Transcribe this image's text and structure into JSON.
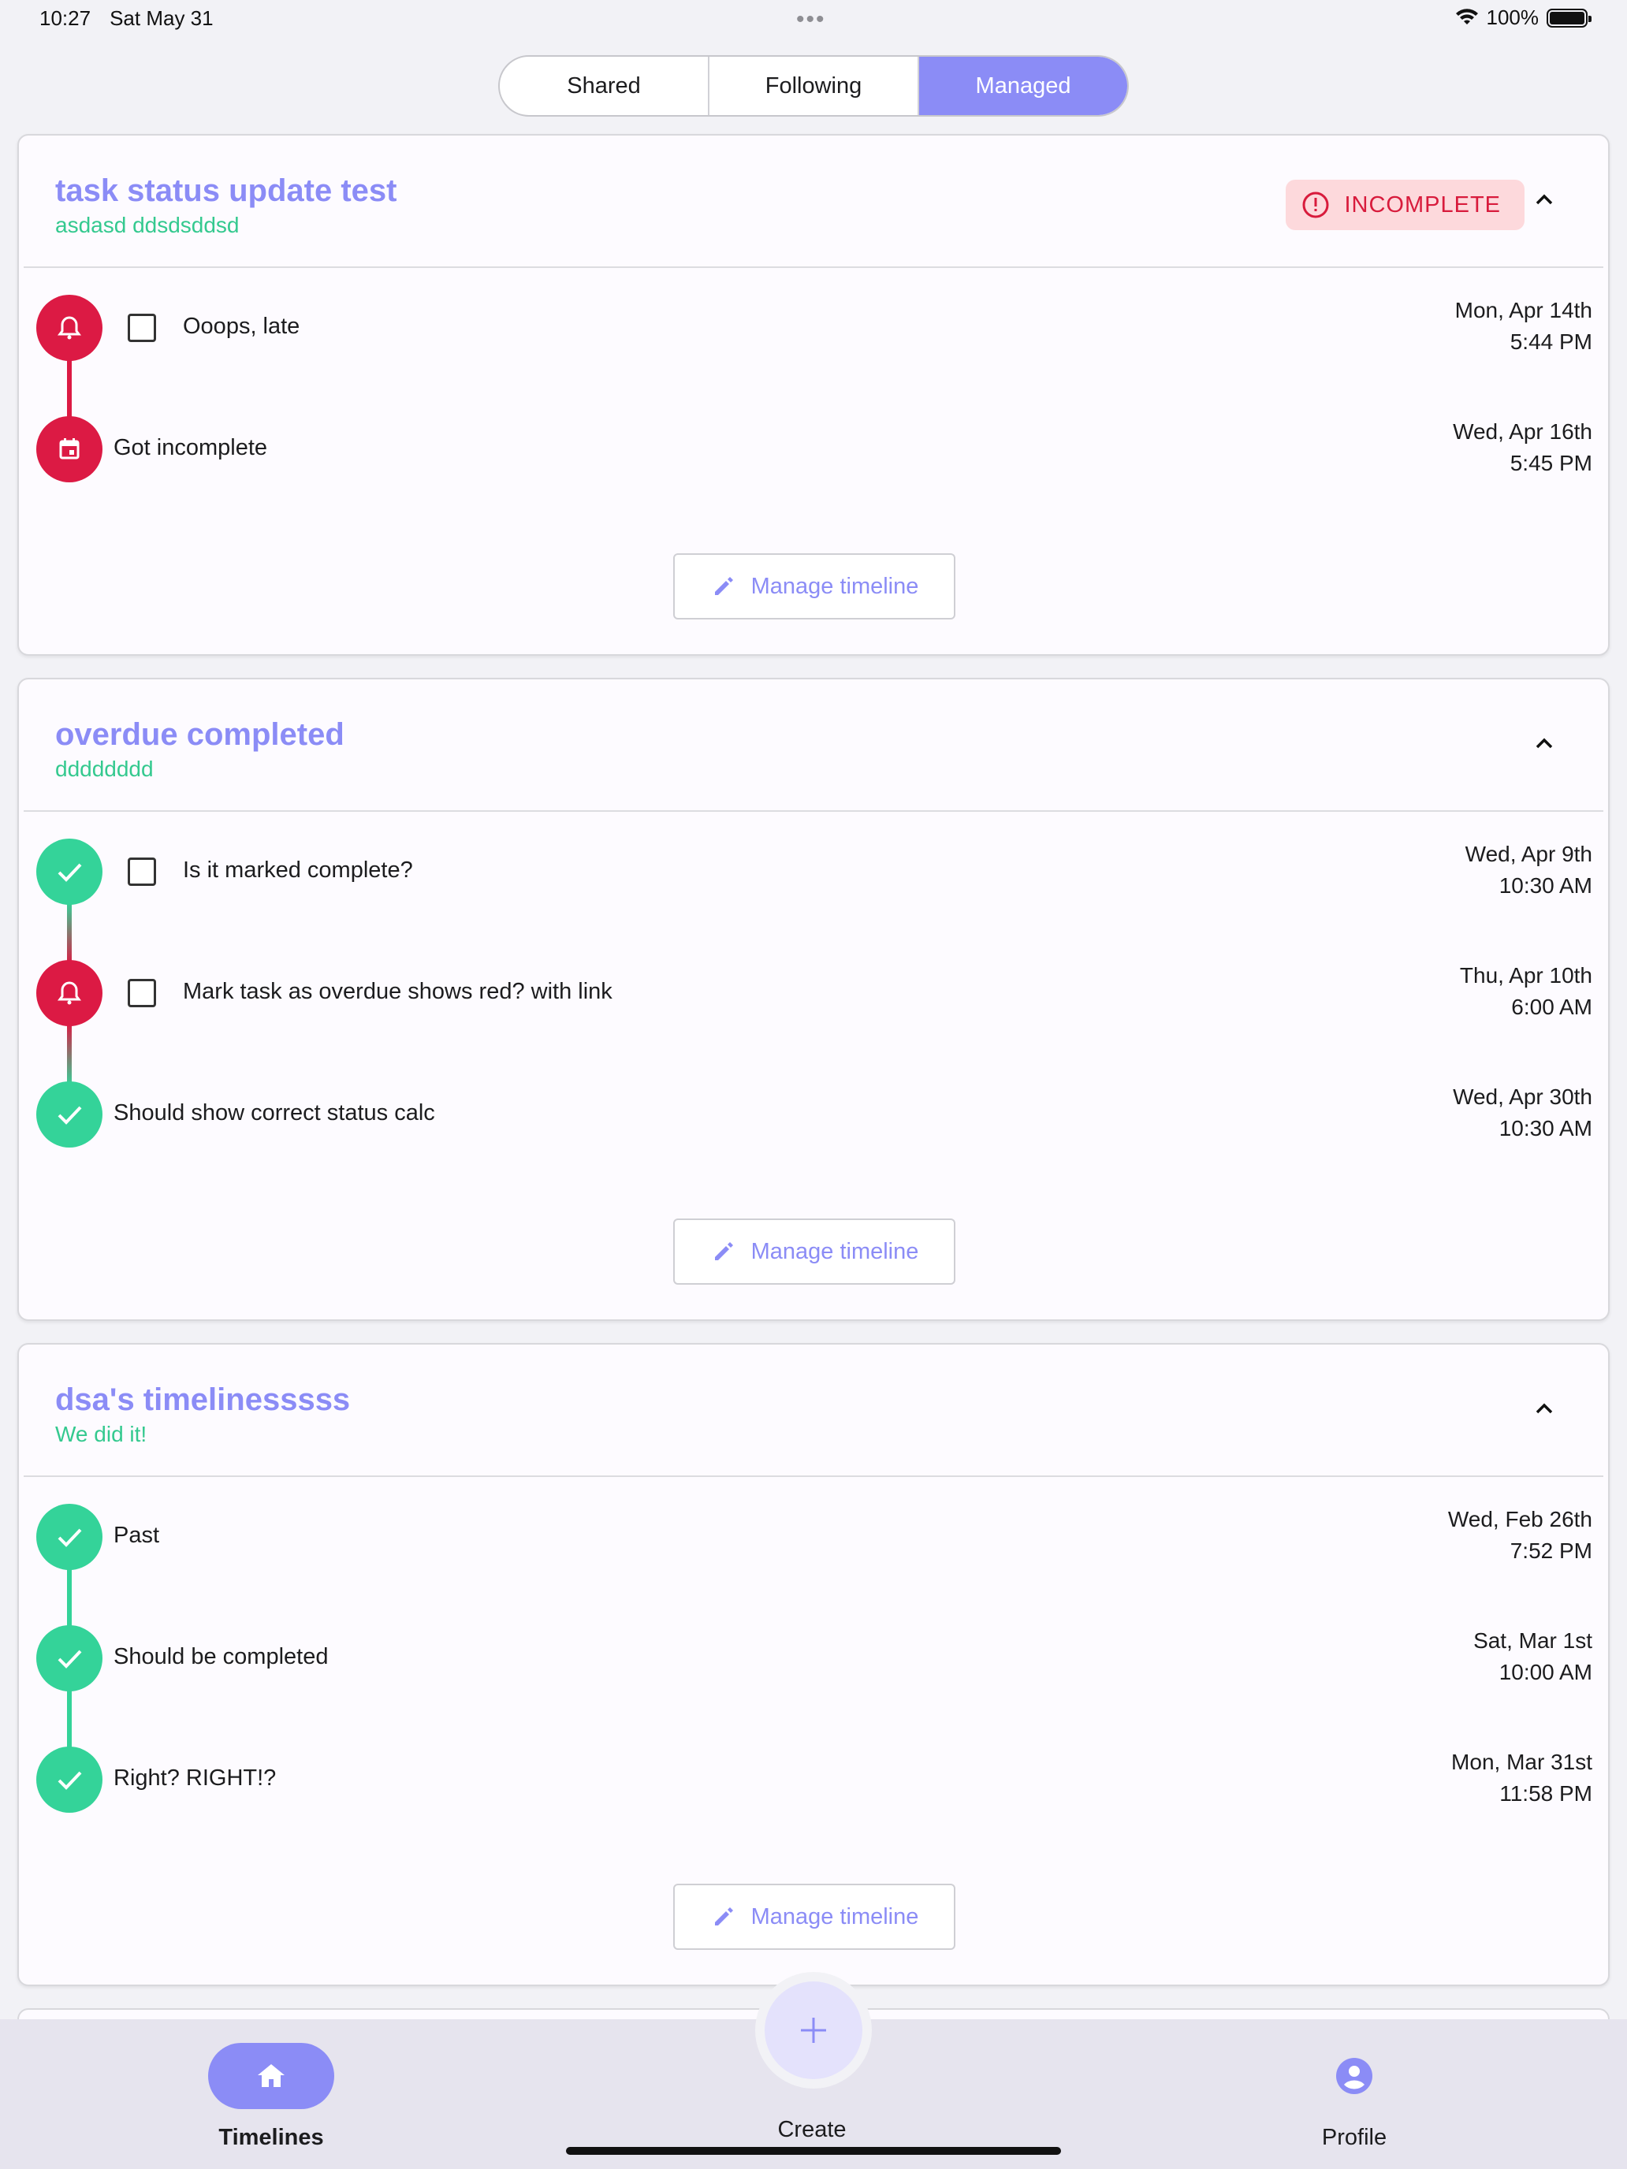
{
  "status_bar": {
    "time": "10:27",
    "date": "Sat May 31",
    "battery": "100%"
  },
  "tabs": [
    {
      "label": "Shared",
      "active": false
    },
    {
      "label": "Following",
      "active": false
    },
    {
      "label": "Managed",
      "active": true
    }
  ],
  "timelines": [
    {
      "title": "task status update test",
      "subtitle": "asdasd ddsdsddsd",
      "badge": "INCOMPLETE",
      "events": [
        {
          "label": "Ooops, late",
          "date": "Mon, Apr 14th",
          "time": "5:44 PM",
          "status": "overdue",
          "icon": "bell-icon",
          "checkbox": true
        },
        {
          "label": "Got incomplete",
          "date": "Wed, Apr 16th",
          "time": "5:45 PM",
          "status": "overdue",
          "icon": "calendar-icon",
          "checkbox": false
        }
      ],
      "manage_label": "Manage timeline"
    },
    {
      "title": "overdue completed",
      "subtitle": "dddddddd",
      "badge": "",
      "events": [
        {
          "label": "Is it marked complete?",
          "date": "Wed, Apr 9th",
          "time": "10:30 AM",
          "status": "complete",
          "icon": "check-icon",
          "checkbox": true
        },
        {
          "label": "Mark task as overdue shows red? with link",
          "date": "Thu, Apr 10th",
          "time": "6:00 AM",
          "status": "overdue",
          "icon": "bell-icon",
          "checkbox": true
        },
        {
          "label": "Should show correct status calc",
          "date": "Wed, Apr 30th",
          "time": "10:30 AM",
          "status": "complete",
          "icon": "check-icon",
          "checkbox": false
        }
      ],
      "manage_label": "Manage timeline"
    },
    {
      "title": "dsa's timelinesssss",
      "subtitle": "We did it!",
      "badge": "",
      "events": [
        {
          "label": "Past",
          "date": "Wed, Feb 26th",
          "time": "7:52 PM",
          "status": "complete",
          "icon": "check-icon",
          "checkbox": false
        },
        {
          "label": "Should be completed",
          "date": "Sat, Mar 1st",
          "time": "10:00 AM",
          "status": "complete",
          "icon": "check-icon",
          "checkbox": false
        },
        {
          "label": "Right? RIGHT!?",
          "date": "Mon, Mar 31st",
          "time": "11:58 PM",
          "status": "complete",
          "icon": "check-icon",
          "checkbox": false
        }
      ],
      "manage_label": "Manage timeline"
    }
  ],
  "bottom_nav": {
    "timelines_label": "Timelines",
    "create_label": "Create",
    "profile_label": "Profile"
  },
  "colors": {
    "accent": "#8b8cf6",
    "success": "#34d399",
    "danger": "#dc1a44",
    "subtitle": "#34c98f"
  }
}
